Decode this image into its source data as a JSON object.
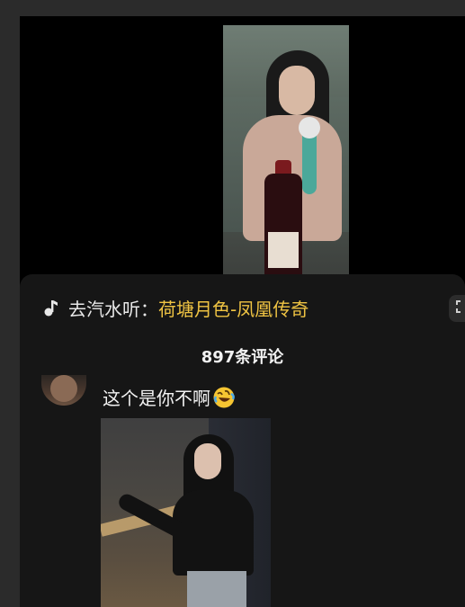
{
  "music": {
    "prefix": "去汽水听：",
    "title": "荷塘月色-凤凰传奇"
  },
  "comments": {
    "count_label": "897条评论",
    "items": [
      {
        "text": "这个是你不啊",
        "emoji": "rolling-on-floor-laughing-emoji"
      }
    ]
  },
  "colors": {
    "panel_bg": "#161616",
    "music_title": "#f0c443",
    "text": "#f2f2f2"
  }
}
